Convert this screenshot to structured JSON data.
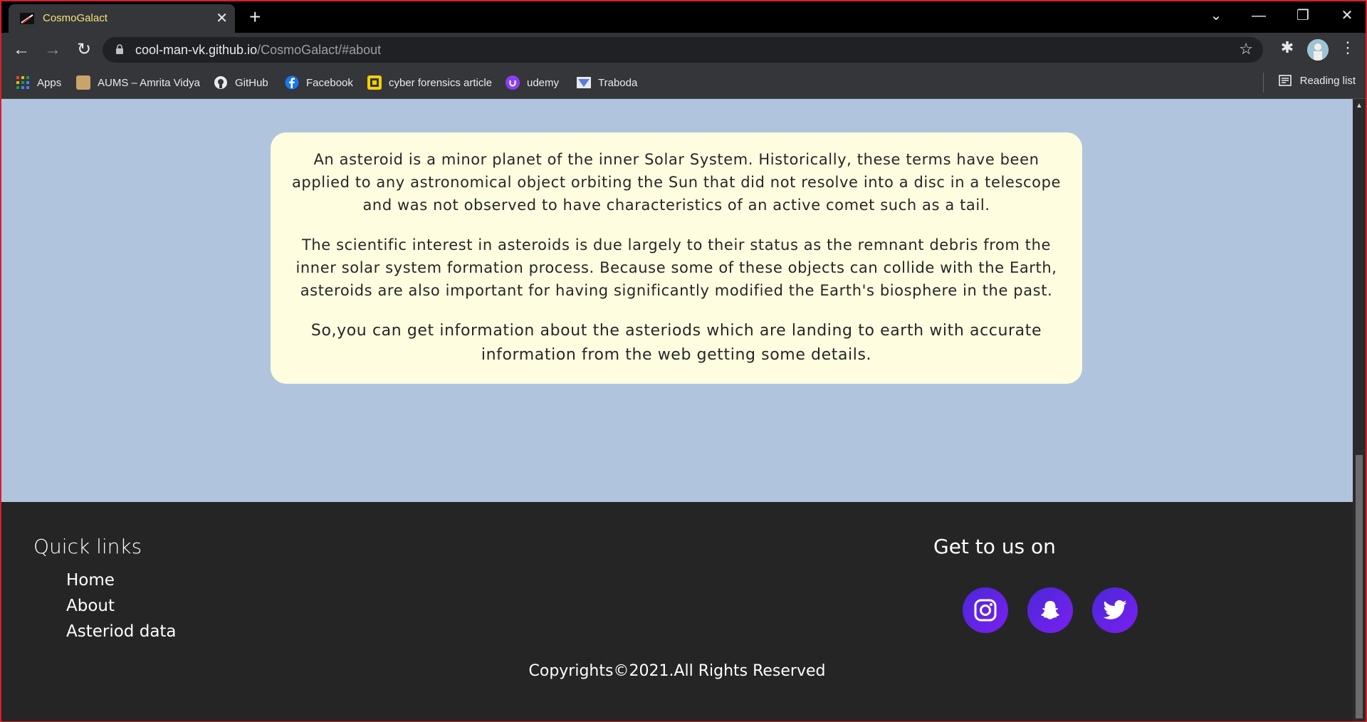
{
  "browser": {
    "tab_title": "CosmoGalact",
    "url_host": "cool-man-vk.github.io",
    "url_path": "/CosmoGalact/#about",
    "reading_list": "Reading list",
    "bookmarks": [
      {
        "label": "Apps",
        "icon": "apps-grid-icon",
        "color": "#e8453c"
      },
      {
        "label": "AUMS – Amrita Vidya",
        "icon": "aums-icon",
        "color": "#c9a46a"
      },
      {
        "label": "GitHub",
        "icon": "github-icon",
        "color": "#e8eaed"
      },
      {
        "label": "Facebook",
        "icon": "facebook-icon",
        "color": "#1877f2"
      },
      {
        "label": "cyber forensics article",
        "icon": "cyber-forensics-icon",
        "color": "#f4d000"
      },
      {
        "label": "udemy",
        "icon": "udemy-icon",
        "color": "#8a3ff0"
      },
      {
        "label": "Traboda",
        "icon": "traboda-icon",
        "color": "#5b7bd5"
      }
    ]
  },
  "about": {
    "paragraphs": [
      "An asteroid is a minor planet of the inner Solar System. Historically, these terms have been applied to any astronomical object orbiting the Sun that did not resolve into a disc in a telescope and was not observed to have characteristics of an active comet such as a tail.",
      "The scientific interest in asteroids is due largely to their status as the remnant debris from the inner solar system formation process. Because some of these objects can collide with the Earth, asteroids are also important for having significantly modified the Earth's biosphere in the past.",
      "So,you can get information about the asteriods which are landing to earth with accurate information from the web getting some details."
    ]
  },
  "footer": {
    "quick_links_title": "Quick links",
    "links": [
      "Home",
      "About",
      "Asteriod data"
    ],
    "social_title": "Get to us on",
    "social": [
      {
        "icon": "instagram-icon"
      },
      {
        "icon": "snapchat-icon"
      },
      {
        "icon": "twitter-icon"
      }
    ],
    "copyright": "Copyrights©2021.All Rights Reserved"
  },
  "colors": {
    "page_bg": "#b0c4de",
    "card_bg": "#fffde0",
    "footer_bg": "#252525",
    "social_gradient_start": "#4a28d8",
    "social_gradient_end": "#7a1ff0",
    "tab_title": "#f5e27a"
  }
}
